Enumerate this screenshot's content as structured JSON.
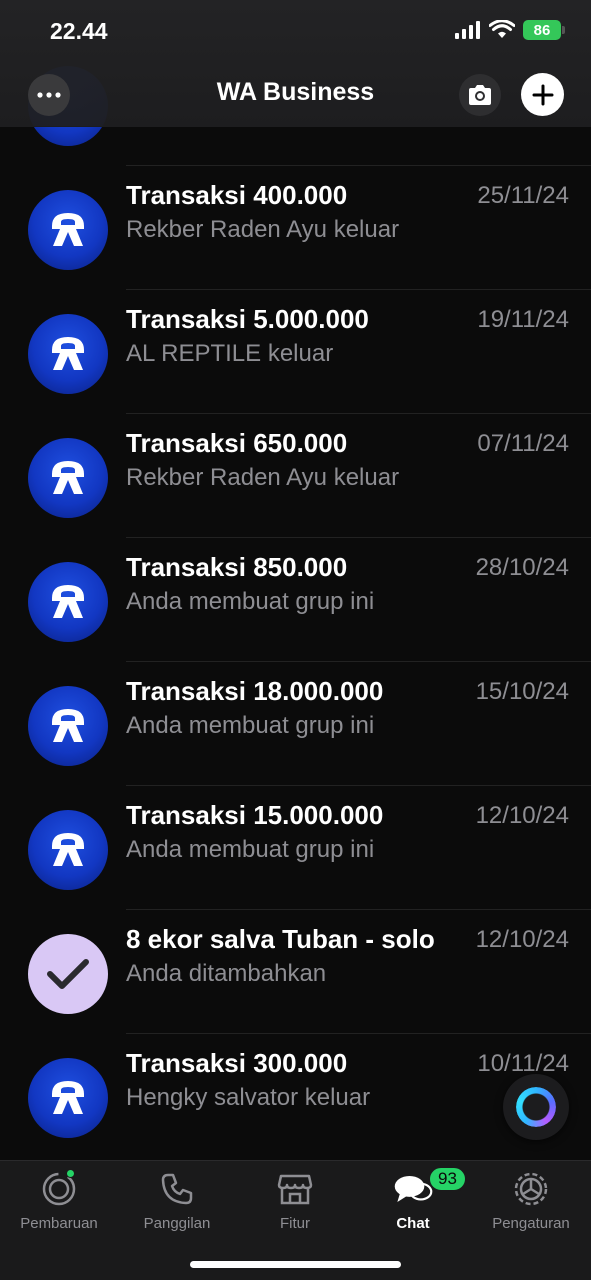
{
  "status_bar": {
    "time": "22.44",
    "battery": "86"
  },
  "header": {
    "title": "WA Business"
  },
  "chats": [
    {
      "name": "Transaksi 400.000",
      "date": "25/11/24",
      "preview": "Rekber Raden Ayu keluar",
      "avatar": "logo"
    },
    {
      "name": "Transaksi 5.000.000",
      "date": "19/11/24",
      "preview": "AL REPTILE keluar",
      "avatar": "logo"
    },
    {
      "name": "Transaksi 650.000",
      "date": "07/11/24",
      "preview": "Rekber Raden Ayu keluar",
      "avatar": "logo"
    },
    {
      "name": "Transaksi 850.000",
      "date": "28/10/24",
      "preview": "Anda membuat grup ini",
      "avatar": "logo"
    },
    {
      "name": "Transaksi 18.000.000",
      "date": "15/10/24",
      "preview": "Anda membuat grup ini",
      "avatar": "logo"
    },
    {
      "name": "Transaksi 15.000.000",
      "date": "12/10/24",
      "preview": "Anda membuat grup ini",
      "avatar": "logo"
    },
    {
      "name": "8 ekor salva Tuban - solo",
      "date": "12/10/24",
      "preview": "Anda ditambahkan",
      "avatar": "check"
    },
    {
      "name": "Transaksi 300.000",
      "date": "10/11/24",
      "preview": "Hengky salvator keluar",
      "avatar": "logo"
    }
  ],
  "tabs": [
    {
      "label": "Pembaruan",
      "icon": "updates-icon"
    },
    {
      "label": "Panggilan",
      "icon": "phone-icon"
    },
    {
      "label": "Fitur",
      "icon": "store-icon"
    },
    {
      "label": "Chat",
      "icon": "chat-icon",
      "active": true
    },
    {
      "label": "Pengaturan",
      "icon": "gear-icon"
    }
  ],
  "chat_badge": "93",
  "colors": {
    "accent": "#25d366",
    "avatar_blue": "#1237c2",
    "avatar_lilac": "#d9c8f5"
  }
}
